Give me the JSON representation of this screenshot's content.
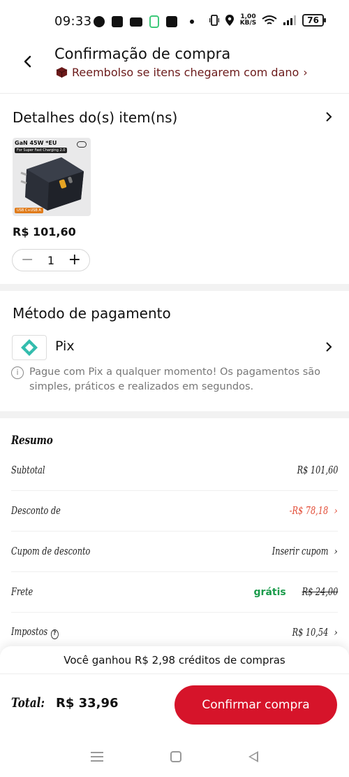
{
  "status_bar": {
    "time": "09:33",
    "speed_value": "1,00",
    "speed_unit": "KB/S",
    "battery": "76",
    "icons": [
      "chat-icon",
      "shopping-bag-icon",
      "youtube-icon",
      "app-icon",
      "pix-icon",
      "dot-icon",
      "vibrate-icon",
      "location-icon",
      "wifi-icon",
      "signal-icon",
      "battery-icon"
    ]
  },
  "header": {
    "title": "Confirmação de compra",
    "refund_text": "Reembolso se itens chegarem com dano",
    "refund_color": "#6b1a1a"
  },
  "items_section": {
    "title": "Detalhes do(s) item(ns)",
    "product": {
      "label_main": "GaN 45W *EU",
      "label_sub": "For Super Fast Charging 2.0",
      "label_ports": "USB C+USB A"
    },
    "price": "R$ 101,60",
    "quantity": "1",
    "minus": "−",
    "plus": "+"
  },
  "payment_section": {
    "title": "Método de pagamento",
    "method": "Pix",
    "note": "Pague com Pix a qualquer momento! Os pagamentos são simples, práticos e realizados em segundos.",
    "pix_color": "#32bcad"
  },
  "summary": {
    "title": "Resumo",
    "rows": [
      {
        "label": "Subtotal",
        "value": "R$ 101,60"
      },
      {
        "label": "Desconto de",
        "value": "-R$ 78,18"
      },
      {
        "label": "Cupom de desconto",
        "value": "Inserir cupom"
      },
      {
        "label": "Frete",
        "free": "grátis",
        "value": "R$ 24,00"
      },
      {
        "label": "Impostos",
        "value": "R$ 10,54"
      }
    ]
  },
  "footer": {
    "credit_text": "Você ganhou R$ 2,98 créditos de compras",
    "total_label": "Total:",
    "total_value": "R$ 33,96",
    "confirm_label": "Confirmar compra",
    "accent_color": "#d6142a"
  }
}
